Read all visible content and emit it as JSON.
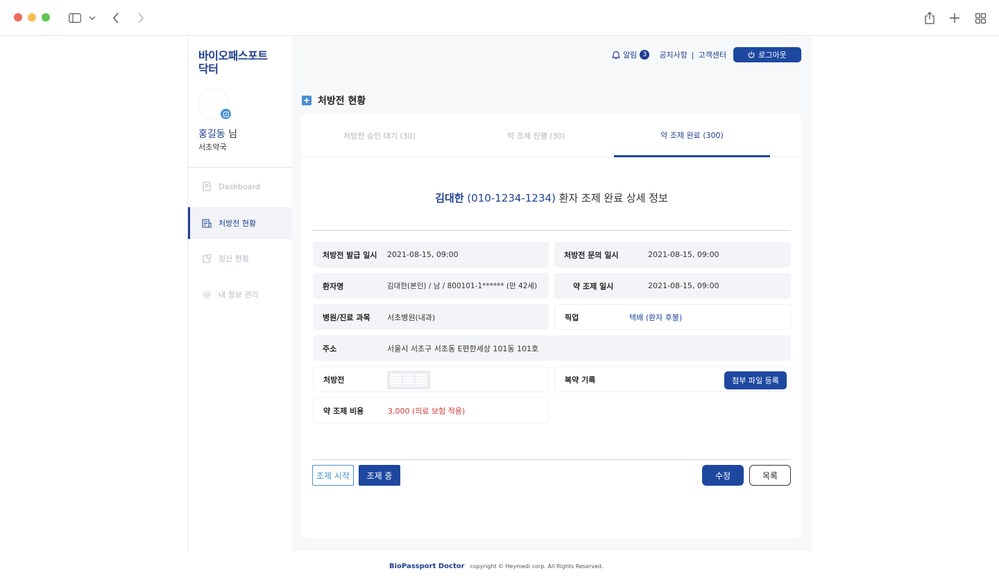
{
  "app": {
    "logo": "바이오패스포트\n닥터",
    "user_name": "홍길동",
    "user_suffix": " 님",
    "user_org": "서초약국"
  },
  "sidebar": {
    "items": [
      {
        "label": "Dashboard",
        "icon": "dashboard-icon",
        "active": false
      },
      {
        "label": "처방전 현황",
        "icon": "prescription-icon",
        "active": true
      },
      {
        "label": "정산 현황",
        "icon": "settlement-icon",
        "active": false
      },
      {
        "label": "내 정보 관리",
        "icon": "gear-icon",
        "active": false
      }
    ]
  },
  "header": {
    "alarm_label": "알림",
    "alarm_count": "3",
    "notice": "공지사항",
    "divider": "|",
    "support": "고객센터",
    "logout": "로그아웃"
  },
  "page_title": "처방전 현황",
  "tabs": [
    {
      "label": "처방전 승인 대기 (30)",
      "active": false
    },
    {
      "label": "약 조제 진행 (30)",
      "active": false
    },
    {
      "label": "약 조제 완료 (300)",
      "active": true
    }
  ],
  "detail": {
    "patient_name": "김대한",
    "patient_phone": " (010-1234-1234)",
    "title_suffix": " 환자 조제 완료 상세 정보",
    "fields": {
      "issued_label": "처방전 발급 일시",
      "issued_value": "2021-08-15, 09:00",
      "inquiry_label": "처방전 문의 일시",
      "inquiry_value": "2021-08-15, 09:00",
      "patient_label": "환자명",
      "patient_value": "김대한(본인) / 남 / 800101-1****** (만 42세)",
      "dispense_label": "약 조제 일시",
      "dispense_value": "2021-08-15, 09:00",
      "hospital_label": "병원/진료 과목",
      "hospital_value": "서초병원(내과)",
      "pickup_label": "픽업",
      "pickup_value": "택배 (환자 후불)",
      "address_label": "주소",
      "address_value": "서울시 서초구 서초동 E편한세상 101동 101호",
      "rx_label": "처방전",
      "record_label": "복약 기록",
      "attach_button": "첨부 파일 등록",
      "cost_label": "약 조제 비용",
      "cost_value": "3,000 (의료 보험 적용)"
    }
  },
  "buttons": {
    "start": "조제 시작",
    "in_progress": "조제 중",
    "edit": "수정",
    "list": "목록"
  },
  "footer": {
    "brand": "BioPassport Doctor",
    "copyright": "copyright © Heymedi corp. All Rights Reserved."
  },
  "colors": {
    "primary": "#1e48a0",
    "primary_dark": "#1e3f91",
    "accent": "#4a8fd1",
    "cost_red": "#d23c3c"
  }
}
